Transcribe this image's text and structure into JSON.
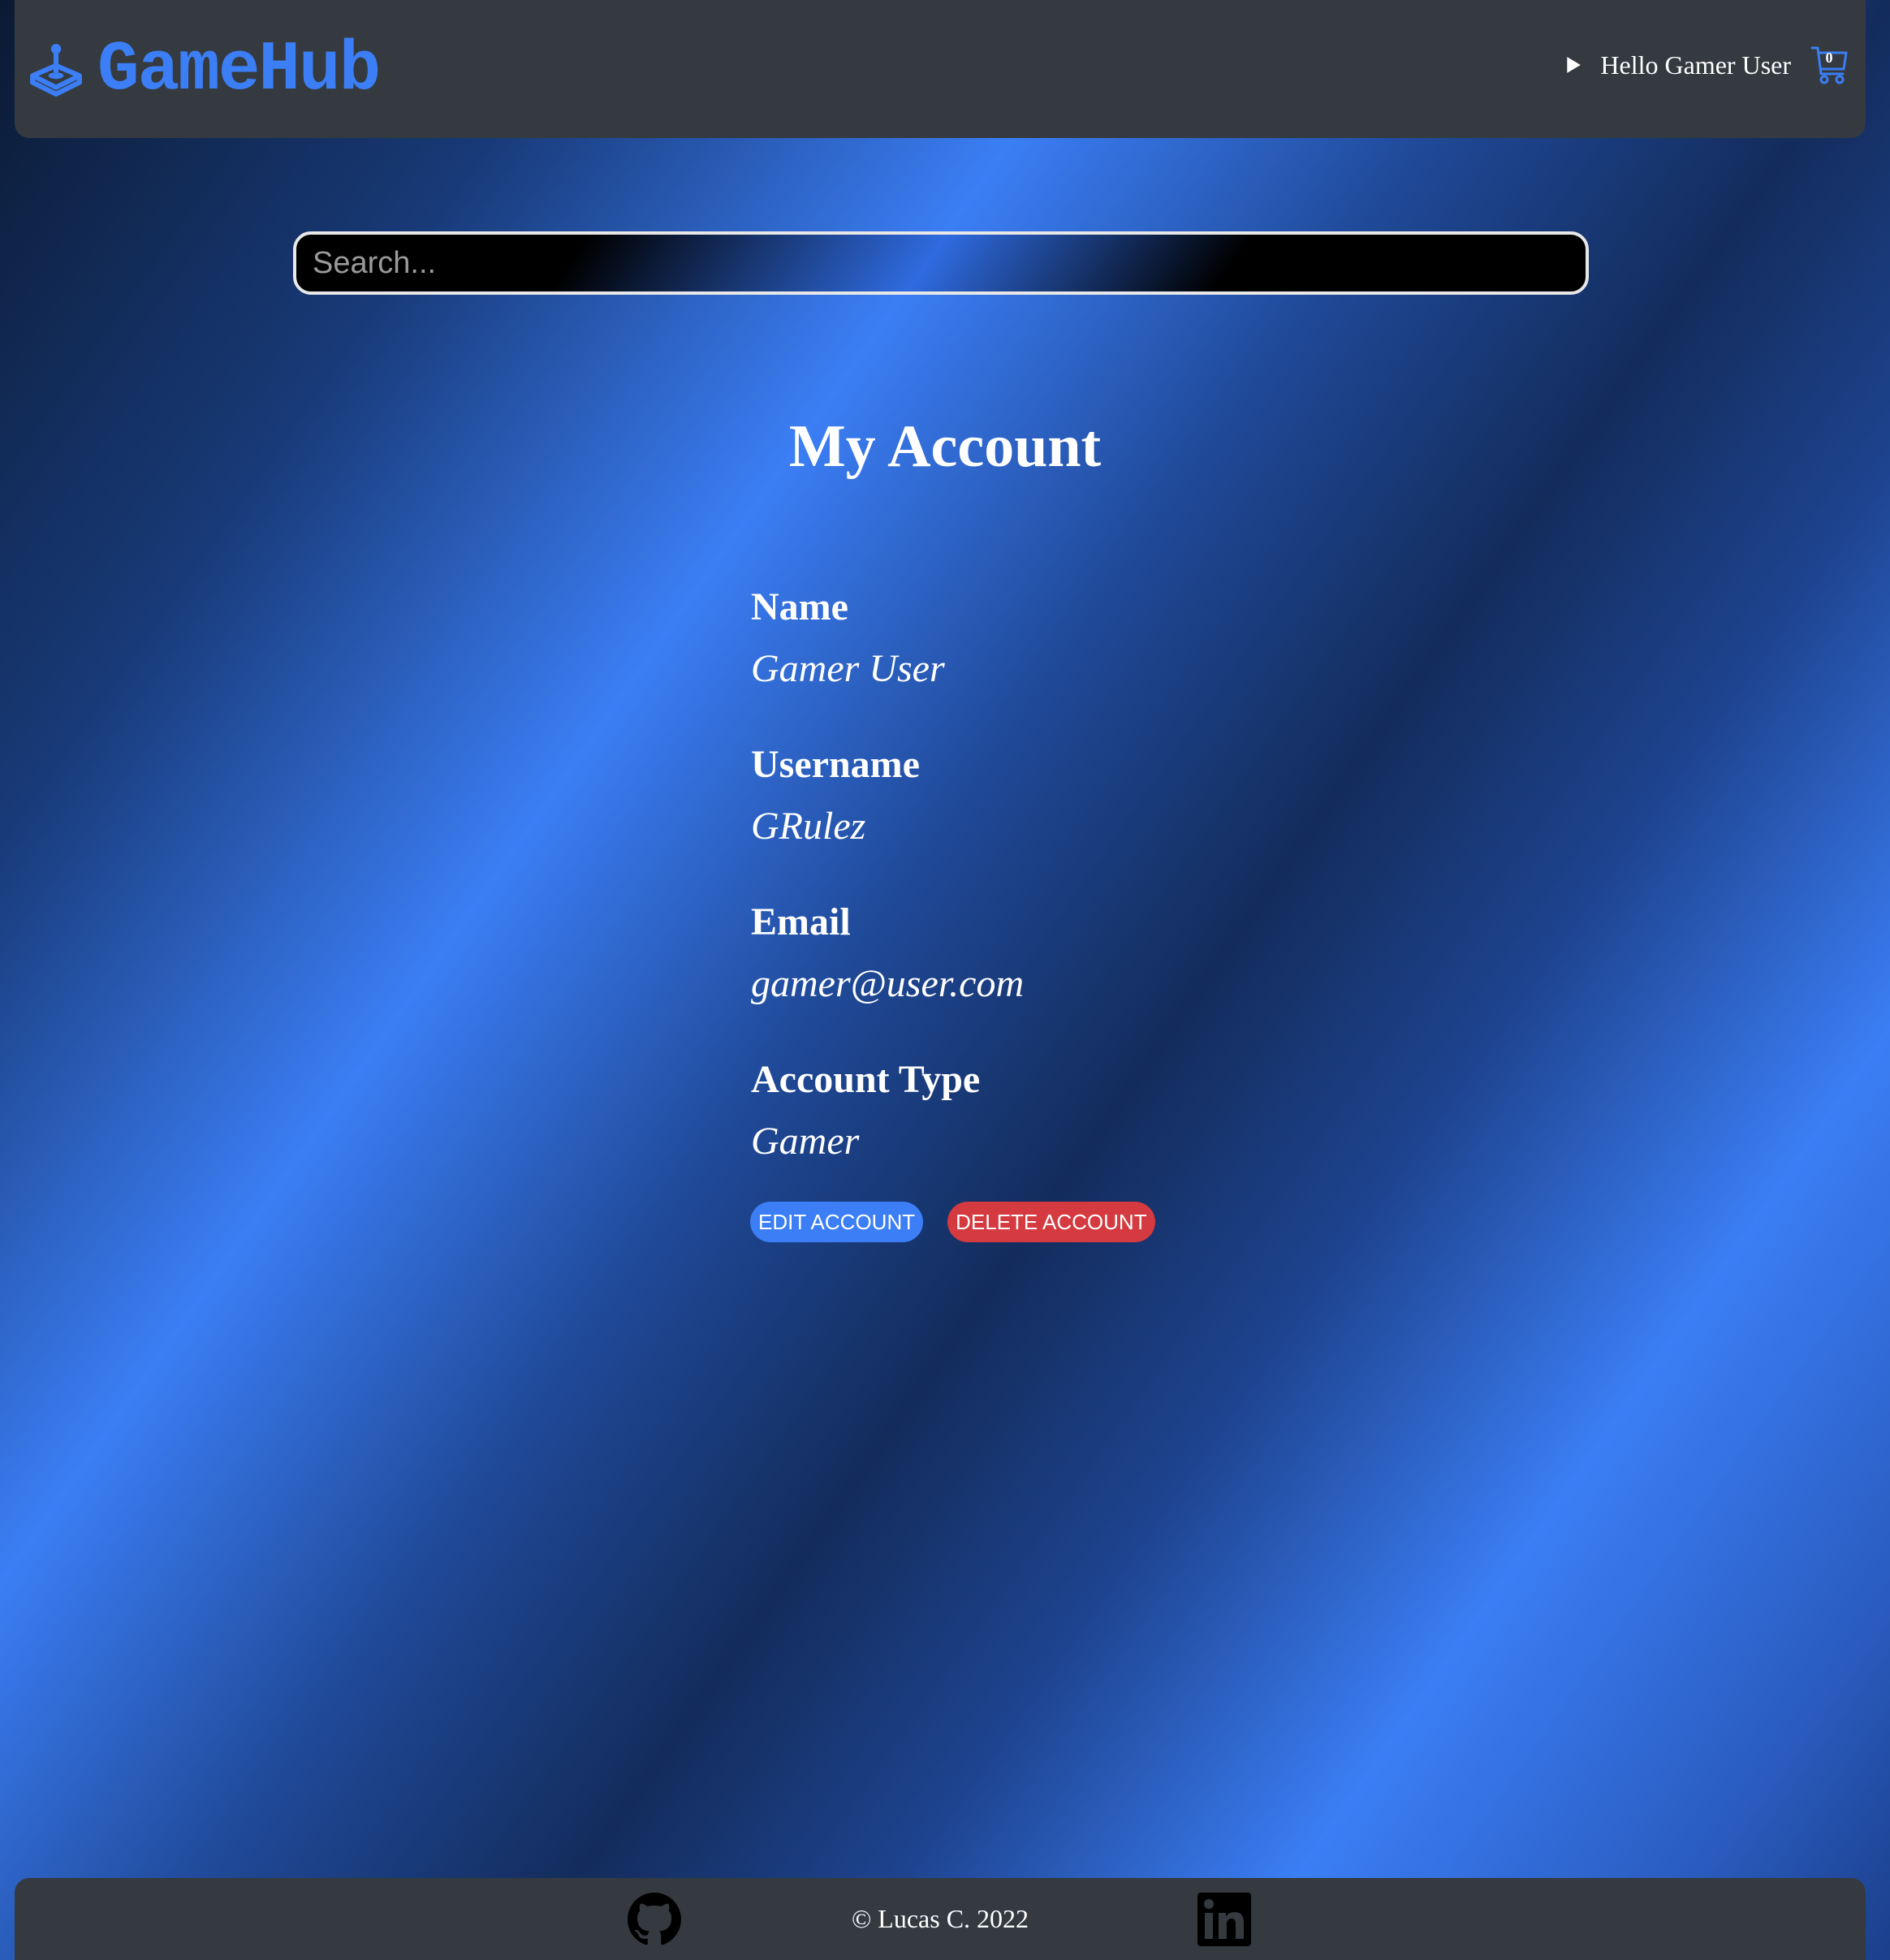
{
  "header": {
    "brand": "GameHub",
    "greeting": "Hello Gamer User",
    "cart_count": "0",
    "icons": {
      "brand": "joystick-icon",
      "menu": "caret-right-icon",
      "cart": "cart-icon"
    }
  },
  "search": {
    "placeholder": "Search...",
    "value": ""
  },
  "main": {
    "title": "My Account",
    "fields": [
      {
        "label": "Name",
        "value": "Gamer User"
      },
      {
        "label": "Username",
        "value": "GRulez"
      },
      {
        "label": "Email",
        "value": "gamer@user.com"
      },
      {
        "label": "Account Type",
        "value": "Gamer"
      }
    ],
    "buttons": {
      "edit_label": "EDIT ACCOUNT",
      "delete_label": "DELETE ACCOUNT"
    }
  },
  "footer": {
    "copyright": "© Lucas C. 2022",
    "icons": {
      "github": "github-icon",
      "linkedin": "linkedin-icon"
    }
  },
  "colors": {
    "accent": "#3b7ef5",
    "danger": "#d43a3f",
    "bar": "#343a40",
    "text": "#ffffff"
  }
}
